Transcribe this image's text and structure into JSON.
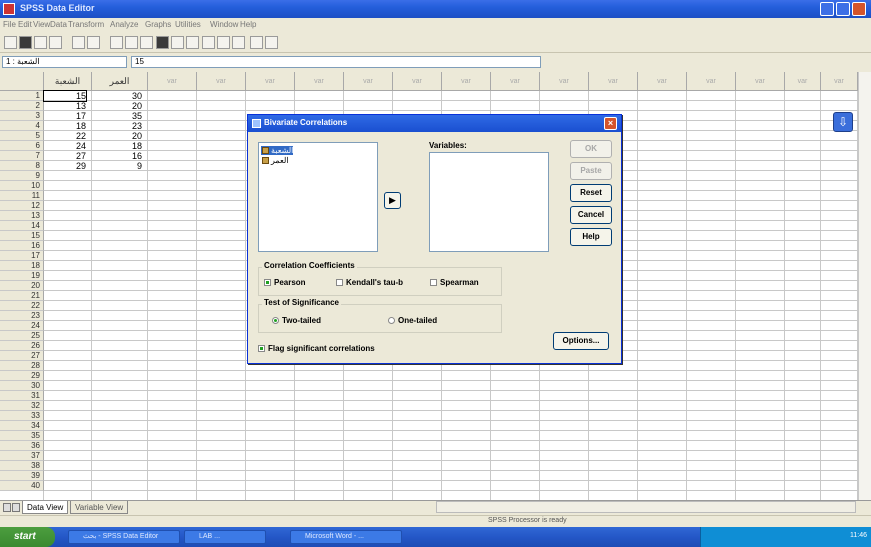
{
  "window": {
    "title": "SPSS Data Editor"
  },
  "menubar": {
    "items": [
      "File",
      "Edit",
      "View",
      "Data",
      "Transform",
      "Analyze",
      "Graphs",
      "Utilities",
      "Window",
      "Help"
    ]
  },
  "cellbar": {
    "ref": "1 : الشعبة",
    "value": "15"
  },
  "grid": {
    "columns": [
      "الشعبة",
      "العمر",
      "var",
      "var",
      "var",
      "var",
      "var",
      "var",
      "var",
      "var",
      "var",
      "var",
      "var",
      "var",
      "var",
      "var",
      "var"
    ],
    "row_numbers": [
      "1",
      "2",
      "3",
      "4",
      "5",
      "6",
      "7",
      "8",
      "9",
      "10",
      "11",
      "12",
      "13",
      "14",
      "15",
      "16",
      "17",
      "18",
      "19",
      "20",
      "21",
      "22",
      "23",
      "24",
      "25",
      "26",
      "27",
      "28",
      "29",
      "30",
      "31",
      "32",
      "33",
      "34",
      "35",
      "36",
      "37",
      "38",
      "39",
      "40"
    ],
    "data": [
      [
        "15",
        "30"
      ],
      [
        "13",
        "20"
      ],
      [
        "17",
        "35"
      ],
      [
        "18",
        "23"
      ],
      [
        "22",
        "20"
      ],
      [
        "24",
        "18"
      ],
      [
        "27",
        "16"
      ],
      [
        "29",
        "9"
      ]
    ]
  },
  "tabs": {
    "data_view": "Data View",
    "variable_view": "Variable View"
  },
  "status": {
    "message": "SPSS Processor is ready"
  },
  "taskbar": {
    "start": "start",
    "tasks": [
      "بحث - SPSS Data Editor",
      "LAB ...",
      "Microsoft Word - ..."
    ],
    "clock": "11:46"
  },
  "dialog": {
    "title": "Bivariate Correlations",
    "source_vars": [
      "الشعبة",
      "العمر"
    ],
    "variables_label": "Variables:",
    "move_arrow": "▶",
    "buttons": {
      "ok": "OK",
      "paste": "Paste",
      "reset": "Reset",
      "cancel": "Cancel",
      "help": "Help",
      "options": "Options..."
    },
    "coefficients": {
      "label": "Correlation Coefficients",
      "pearson": "Pearson",
      "kendall": "Kendall's tau-b",
      "spearman": "Spearman"
    },
    "significance": {
      "label": "Test of Significance",
      "two_tailed": "Two-tailed",
      "one_tailed": "One-tailed"
    },
    "flag": "Flag significant correlations"
  },
  "colors": {
    "titlebar": "#245edb",
    "dialog_bg": "#ece9d8",
    "selection": "#316ac5"
  }
}
